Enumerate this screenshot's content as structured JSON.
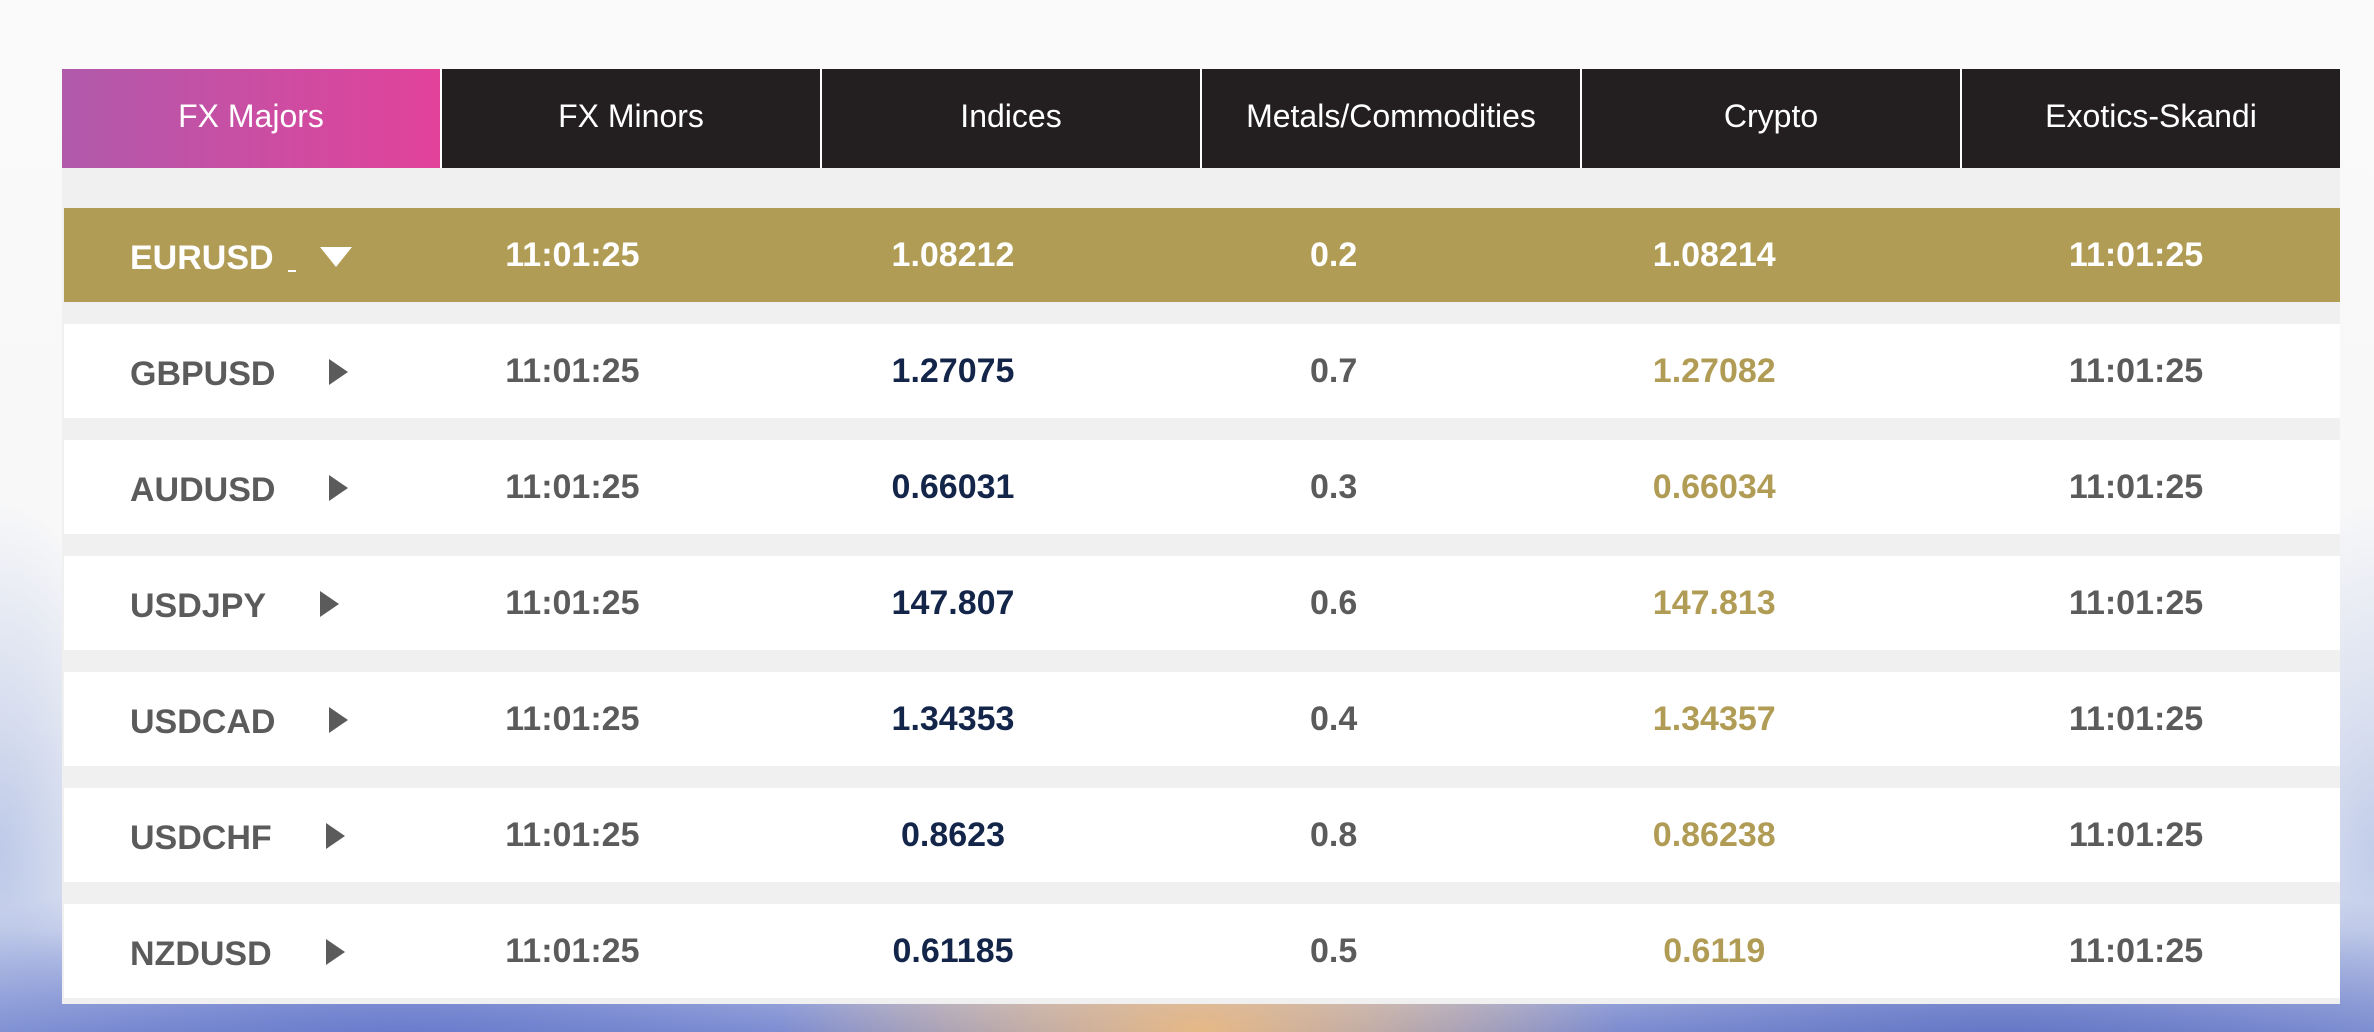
{
  "tabs": [
    {
      "label": "FX Majors",
      "active": true
    },
    {
      "label": "FX Minors",
      "active": false
    },
    {
      "label": "Indices",
      "active": false
    },
    {
      "label": "Metals/Commodities",
      "active": false
    },
    {
      "label": "Crypto",
      "active": false
    },
    {
      "label": "Exotics-Skandi",
      "active": false
    }
  ],
  "rows": [
    {
      "symbol": "EURUSD",
      "time": "11:01:25",
      "bid": "1.08212",
      "spread": "0.2",
      "ask": "1.08214",
      "time2": "11:01:25",
      "expanded": true,
      "icon": "caret-down-icon"
    },
    {
      "symbol": "GBPUSD",
      "time": "11:01:25",
      "bid": "1.27075",
      "spread": "0.7",
      "ask": "1.27082",
      "time2": "11:01:25",
      "expanded": false,
      "icon": "caret-right-icon"
    },
    {
      "symbol": "AUDUSD",
      "time": "11:01:25",
      "bid": "0.66031",
      "spread": "0.3",
      "ask": "0.66034",
      "time2": "11:01:25",
      "expanded": false,
      "icon": "caret-right-icon"
    },
    {
      "symbol": "USDJPY",
      "time": "11:01:25",
      "bid": "147.807",
      "spread": "0.6",
      "ask": "147.813",
      "time2": "11:01:25",
      "expanded": false,
      "icon": "caret-right-icon"
    },
    {
      "symbol": "USDCAD",
      "time": "11:01:25",
      "bid": "1.34353",
      "spread": "0.4",
      "ask": "1.34357",
      "time2": "11:01:25",
      "expanded": false,
      "icon": "caret-right-icon"
    },
    {
      "symbol": "USDCHF",
      "time": "11:01:25",
      "bid": "0.8623",
      "spread": "0.8",
      "ask": "0.86238",
      "time2": "11:01:25",
      "expanded": false,
      "icon": "caret-right-icon"
    },
    {
      "symbol": "NZDUSD",
      "time": "11:01:25",
      "bid": "0.61185",
      "spread": "0.5",
      "ask": "0.6119",
      "time2": "11:01:25",
      "expanded": false,
      "icon": "caret-right-icon"
    }
  ],
  "colors": {
    "tab_bar": "#231f20",
    "active_tab_from": "#b05aac",
    "active_tab_to": "#e2429a",
    "expanded_row": "#b19c56",
    "bid_text": "#14254a",
    "ask_text": "#b19c56",
    "default_text": "#5b5b5b"
  }
}
